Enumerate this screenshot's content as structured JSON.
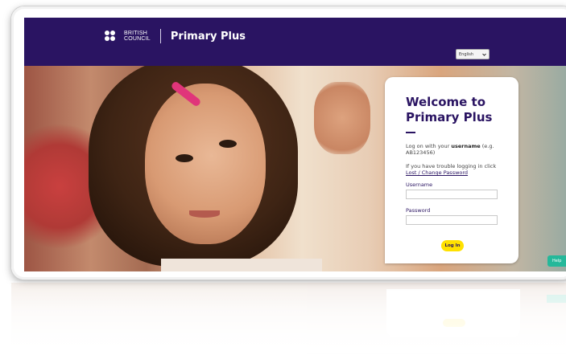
{
  "header": {
    "brand_line1": "BRITISH",
    "brand_line2": "COUNCIL",
    "product_name": "Primary Plus",
    "language_selected": "English",
    "language_chevron_icon": "chevron-down-icon"
  },
  "login_panel": {
    "title": "Welcome to Primary Plus",
    "instruction_prefix": "Log on with your ",
    "instruction_bold": "username",
    "instruction_suffix": " (e.g. AB123456)",
    "trouble_text": "If you have trouble logging in click ",
    "trouble_link": "Lost / Change Password",
    "username_label": "Username",
    "username_value": "",
    "password_label": "Password",
    "password_value": "",
    "login_button": "Log In"
  },
  "help_tab": "Help",
  "colors": {
    "brand_purple": "#2a1462",
    "button_yellow": "#ffe100",
    "help_green": "#25b89a"
  }
}
